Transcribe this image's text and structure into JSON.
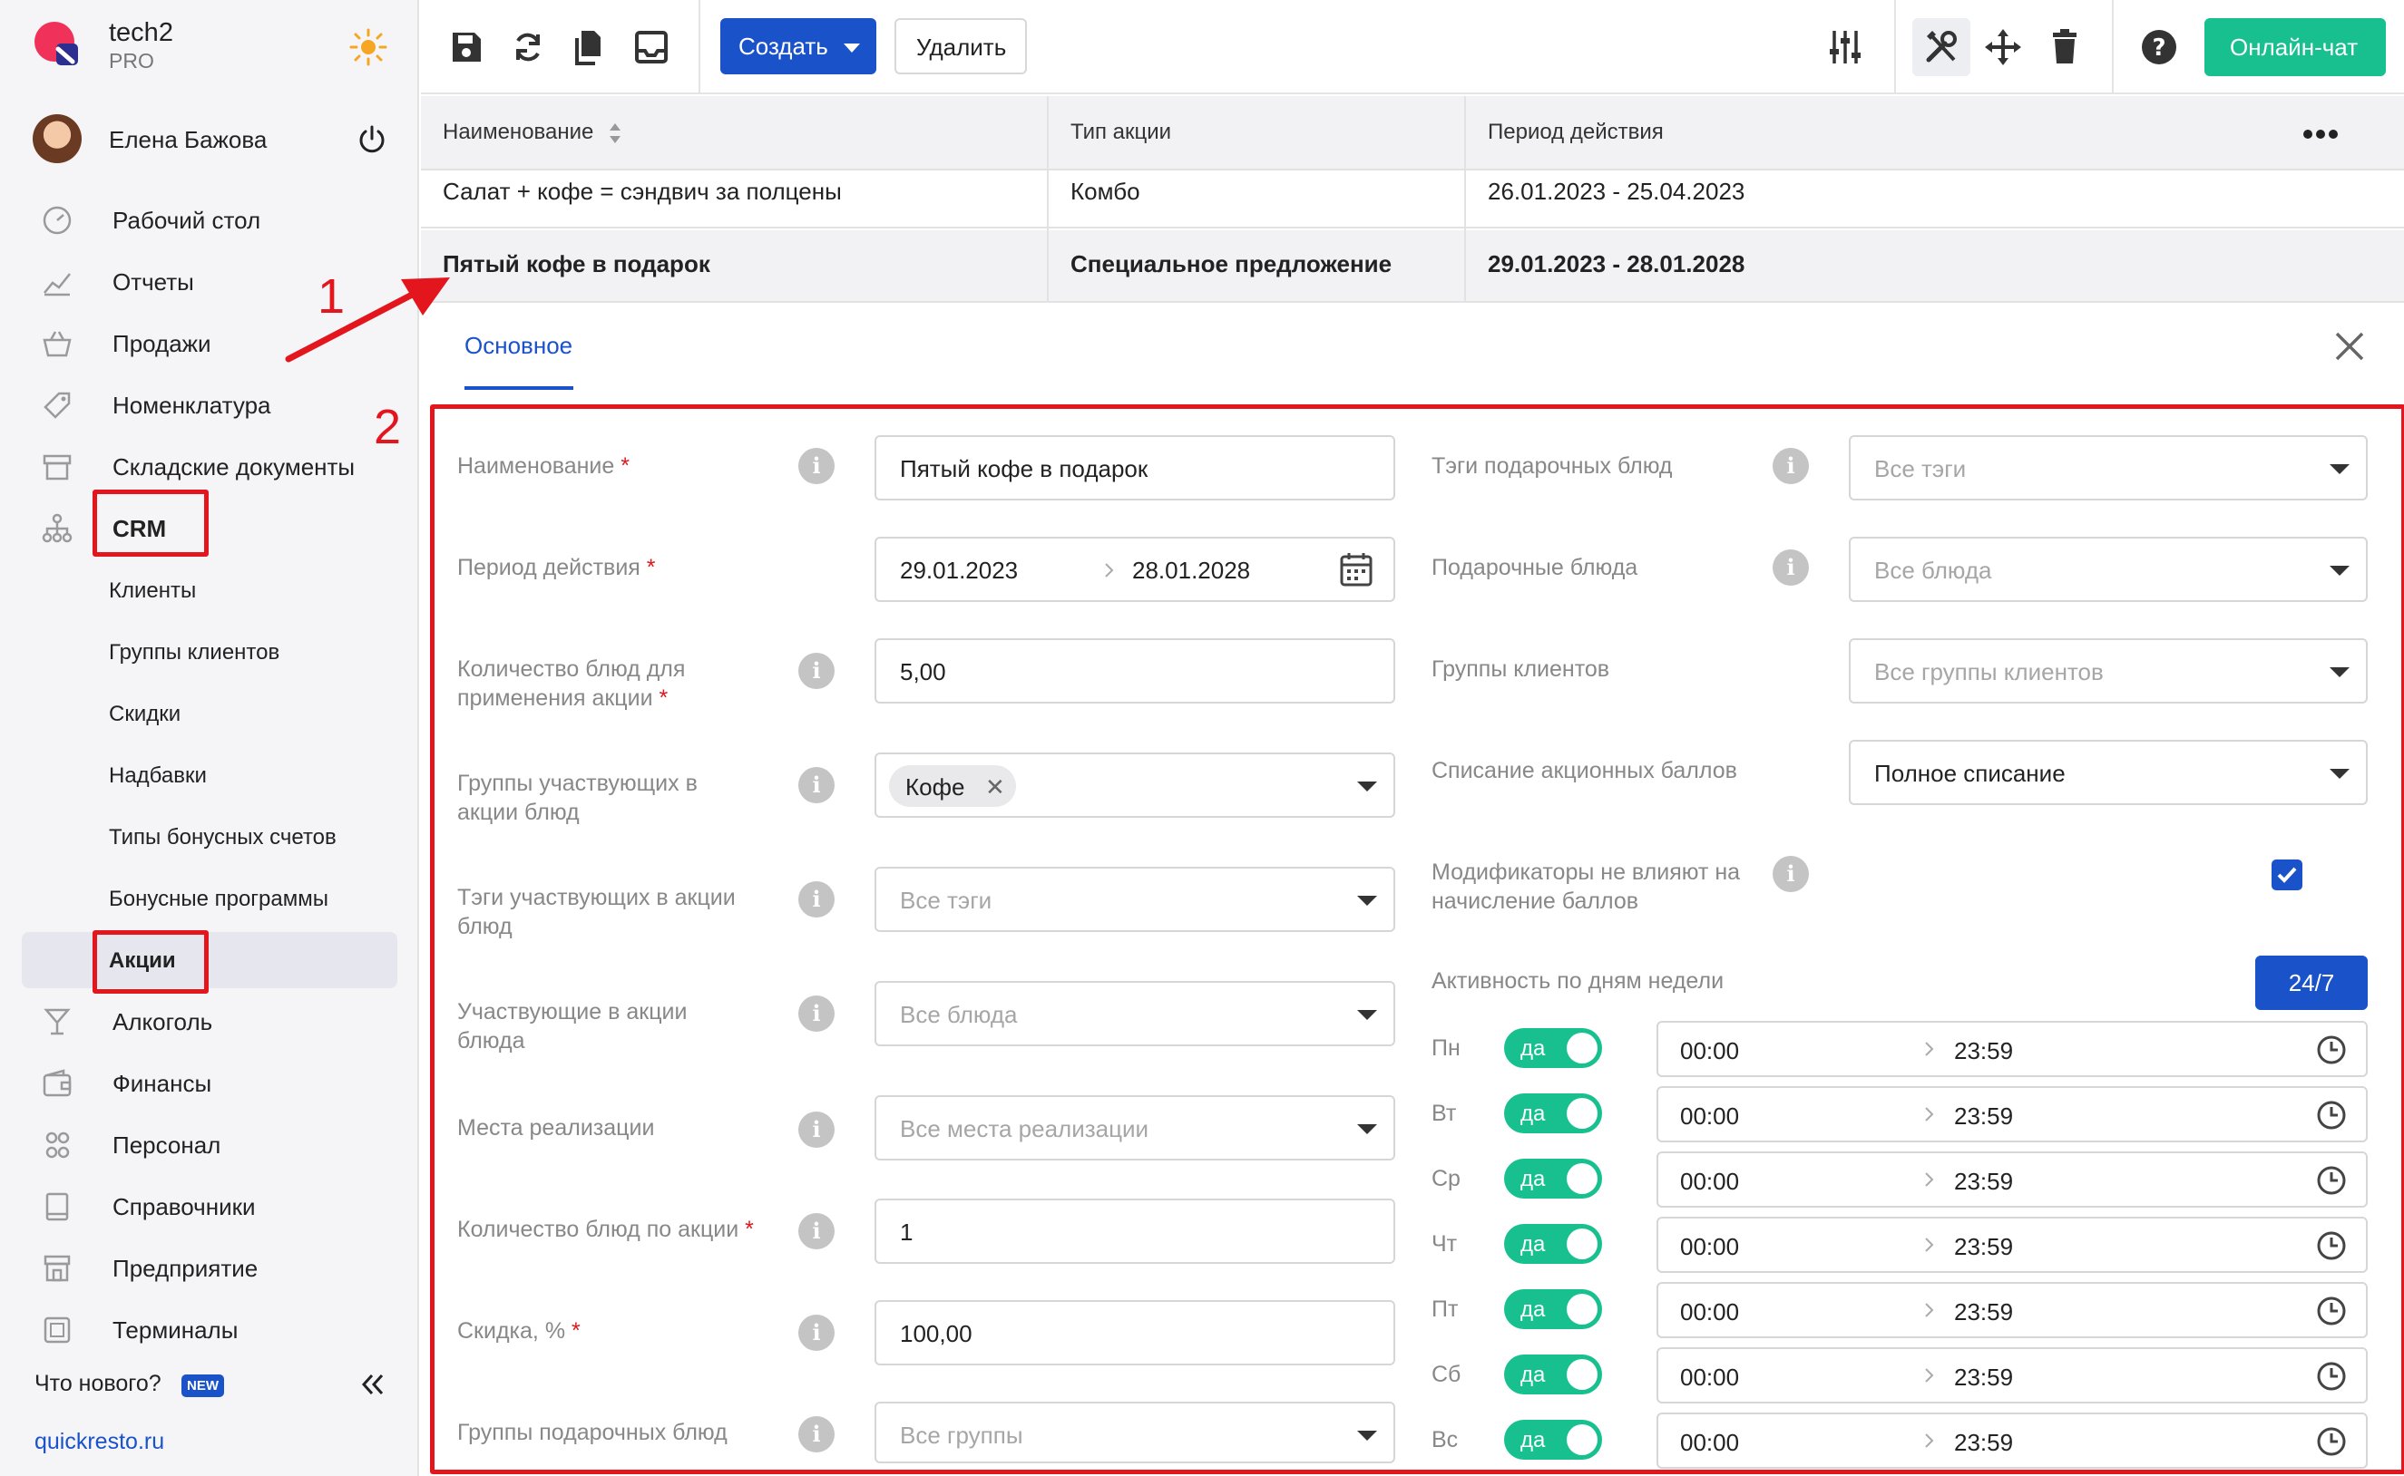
{
  "brand": {
    "name": "tech2",
    "plan": "PRO"
  },
  "user": {
    "name": "Елена Бажова"
  },
  "nav": {
    "items": [
      {
        "label": "Рабочий стол",
        "icon": "dashboard-icon"
      },
      {
        "label": "Отчеты",
        "icon": "chart-icon"
      },
      {
        "label": "Продажи",
        "icon": "basket-icon"
      },
      {
        "label": "Номенклатура",
        "icon": "tag-icon"
      },
      {
        "label": "Складские документы",
        "icon": "archive-icon"
      },
      {
        "label": "CRM",
        "icon": "org-chart-icon"
      }
    ],
    "crm_sub": [
      "Клиенты",
      "Группы клиентов",
      "Скидки",
      "Надбавки",
      "Типы бонусных счетов",
      "Бонусные программы",
      "Акции"
    ],
    "items2": [
      {
        "label": "Алкоголь",
        "icon": "glass-icon"
      },
      {
        "label": "Финансы",
        "icon": "wallet-icon"
      },
      {
        "label": "Персонал",
        "icon": "people-icon"
      },
      {
        "label": "Справочники",
        "icon": "book-icon"
      },
      {
        "label": "Предприятие",
        "icon": "store-icon"
      },
      {
        "label": "Терминалы",
        "icon": "terminal-icon"
      }
    ],
    "whats_new": "Что нового?",
    "new_badge": "NEW",
    "site": "quickresto.ru"
  },
  "annotations": {
    "one": "1",
    "two": "2"
  },
  "toolbar": {
    "create": "Создать",
    "delete": "Удалить",
    "chat": "Онлайн-чат"
  },
  "table": {
    "headers": [
      "Наименование",
      "Тип акции",
      "Период действия"
    ],
    "rows": [
      [
        "Салат + кофе = сэндвич за полцены",
        "Комбо",
        "26.01.2023 - 25.04.2023"
      ],
      [
        "Пятый кофе в подарок",
        "Специальное предложение",
        "29.01.2023 - 28.01.2028"
      ]
    ]
  },
  "tab": "Основное",
  "form": {
    "name": {
      "label": "Наименование",
      "value": "Пятый кофе в подарок"
    },
    "period": {
      "label": "Период действия",
      "from": "29.01.2023",
      "to": "28.01.2028"
    },
    "dish_count": {
      "label": "Количество блюд для применения акции",
      "value": "5,00"
    },
    "groups": {
      "label": "Группы участвующих в акции блюд",
      "chip": "Кофе"
    },
    "tags": {
      "label": "Тэги участвующих в акции блюд",
      "placeholder": "Все тэги"
    },
    "dishes": {
      "label": "Участвующие в акции блюда",
      "placeholder": "Все блюда"
    },
    "places": {
      "label": "Места реализации",
      "placeholder": "Все места реализации"
    },
    "promo_count": {
      "label": "Количество блюд по акции",
      "value": "1"
    },
    "discount": {
      "label": "Скидка, %",
      "value": "100,00"
    },
    "gift_groups": {
      "label": "Группы подарочных блюд",
      "placeholder": "Все группы"
    },
    "gift_tags": {
      "label": "Тэги подарочных блюд",
      "placeholder": "Все тэги"
    },
    "gift_dishes": {
      "label": "Подарочные блюда",
      "placeholder": "Все блюда"
    },
    "client_groups": {
      "label": "Группы клиентов",
      "placeholder": "Все группы клиентов"
    },
    "points": {
      "label": "Списание акционных баллов",
      "value": "Полное списание"
    },
    "modifiers": {
      "label": "Модификаторы не влияют на начисление баллов",
      "checked": true
    },
    "activity": {
      "label": "Активность по дням недели",
      "btn": "24/7"
    },
    "days": [
      {
        "d": "Пн",
        "on": "да",
        "from": "00:00",
        "to": "23:59"
      },
      {
        "d": "Вт",
        "on": "да",
        "from": "00:00",
        "to": "23:59"
      },
      {
        "d": "Ср",
        "on": "да",
        "from": "00:00",
        "to": "23:59"
      },
      {
        "d": "Чт",
        "on": "да",
        "from": "00:00",
        "to": "23:59"
      },
      {
        "d": "Пт",
        "on": "да",
        "from": "00:00",
        "to": "23:59"
      },
      {
        "d": "Сб",
        "on": "да",
        "from": "00:00",
        "to": "23:59"
      },
      {
        "d": "Вс",
        "on": "да",
        "from": "00:00",
        "to": "23:59"
      }
    ]
  },
  "colors": {
    "accent": "#1a52c9",
    "toggle": "#17c08e",
    "annotation": "#e3161d"
  }
}
